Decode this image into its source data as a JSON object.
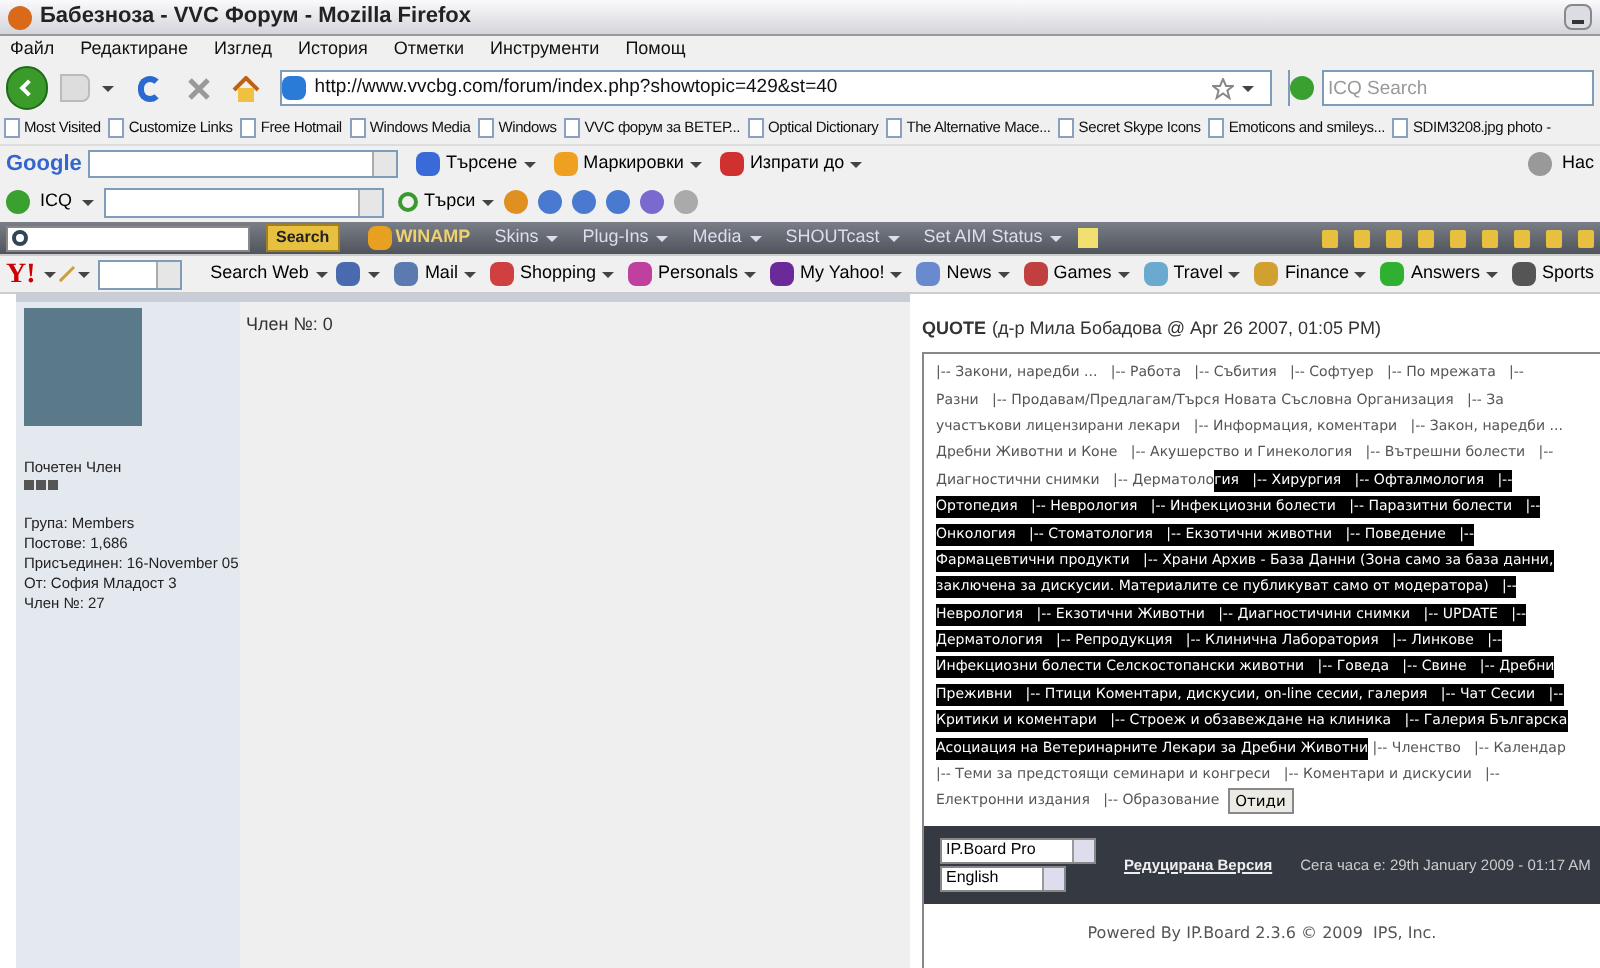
{
  "window": {
    "title": "Бабезноза - VVC Форум - Mozilla Firefox"
  },
  "menu": [
    "Файл",
    "Редактиране",
    "Изглед",
    "История",
    "Отметки",
    "Инструменти",
    "Помощ"
  ],
  "nav": {
    "url": "http://www.vvcbg.com/forum/index.php?showtopic=429&st=40",
    "search_placeholder": "ICQ Search"
  },
  "bookmarks": [
    "Most Visited",
    "Customize Links",
    "Free Hotmail",
    "Windows Media",
    "Windows",
    "VVC форум за ВЕТЕР...",
    "Optical Dictionary",
    "The Alternative Mace...",
    "Secret Skype Icons",
    "Emoticons and smileys...",
    "SDIM3208.jpg photo -"
  ],
  "google_toolbar": {
    "logo": "Google",
    "items": [
      "Търсене",
      "Маркировки",
      "Изпрати до"
    ],
    "cut_label": "Нас"
  },
  "icq_toolbar": {
    "label": "ICQ",
    "search": "Търси"
  },
  "winamp_toolbar": {
    "search_button": "Search",
    "logo": "WINAMP",
    "menus": [
      "Skins",
      "Plug-Ins",
      "Media",
      "SHOUTcast",
      "Set AIM Status"
    ]
  },
  "yahoo_toolbar": {
    "logo": "Y!",
    "search": "Search Web",
    "items": [
      "Mail",
      "Shopping",
      "Personals",
      "My Yahoo!",
      "News",
      "Games",
      "Travel",
      "Finance",
      "Answers",
      "Sports"
    ]
  },
  "profile": {
    "title": "Почетен Член",
    "details": [
      "Група: Members",
      "Постове: 1,686",
      "Присъединен: 16-November 05",
      "От: София Младост 3",
      "Член №: 27"
    ]
  },
  "post": {
    "member_no": "Член №: 0"
  },
  "quote": {
    "label": "QUOTE",
    "source": "(д-р Мила Бобадова @ Apr 26 2007, 01:05 PM)",
    "lines": [
      {
        "segments": [
          {
            "text": "|-- Закони, наредби ...   |-- Работа   |-- Събития   |-- Софтуер   |-- По мрежата   |--",
            "highlighted": false
          }
        ]
      },
      {
        "segments": [
          {
            "text": "Разни   |-- Продавам/Предлагам/Търся Новата Съсловна Организация   |-- За",
            "highlighted": false
          }
        ]
      },
      {
        "segments": [
          {
            "text": "участъкови лицензирани лекари   |-- Информация, коментари   |-- Закон, наредби ...",
            "highlighted": false
          }
        ]
      },
      {
        "segments": [
          {
            "text": "Дребни Животни и Коне   |-- Акушерство и Гинекология   |-- Вътрешни болести   |--",
            "highlighted": false
          }
        ]
      },
      {
        "segments": [
          {
            "text": "Диагностични снимки   |-- Дерматоло",
            "highlighted": false
          },
          {
            "text": "гия   |-- Хирургия   |-- Офталмология   |--",
            "highlighted": true
          }
        ]
      },
      {
        "segments": [
          {
            "text": "Ортопедия   |-- Неврология   |-- Инфекциозни болести   |-- Паразитни болести   |--",
            "highlighted": true
          }
        ]
      },
      {
        "segments": [
          {
            "text": "Онкология   |-- Стоматология   |-- Екзотични животни   |-- Поведение   |--",
            "highlighted": true
          }
        ]
      },
      {
        "segments": [
          {
            "text": "Фармацевтични продукти   |-- Храни Архив - База Данни (Зона само за база данни,",
            "highlighted": true
          }
        ]
      },
      {
        "segments": [
          {
            "text": "заключена за дискусии. Материалите се публикуват само от модератора)   |--",
            "highlighted": true
          }
        ]
      },
      {
        "segments": [
          {
            "text": "Неврология   |-- Екзотични Животни   |-- Диагностичини снимки   |-- UPDATE   |--",
            "highlighted": true
          }
        ]
      },
      {
        "segments": [
          {
            "text": "Дерматология   |-- Репродукция   |-- Клинична Лаборатория   |-- Линкове   |--",
            "highlighted": true
          }
        ]
      },
      {
        "segments": [
          {
            "text": "Инфекциозни болести Селскостопански животни   |-- Говеда   |-- Свине   |-- Дребни",
            "highlighted": true
          }
        ]
      },
      {
        "segments": [
          {
            "text": "Преживни   |-- Птици Коментари, дискусии, on-line сесии, галерия   |-- Чат Сесии   |--",
            "highlighted": true
          }
        ]
      },
      {
        "segments": [
          {
            "text": "Критики и коментари   |-- Строеж и обзавеждане на клиника   |-- Галерия Българска",
            "highlighted": true
          }
        ]
      },
      {
        "segments": [
          {
            "text": "Асоциация на Ветеринарните Лекари за Дребни Животни",
            "highlighted": true
          },
          {
            "text": " |-- Членство   |-- Календар",
            "highlighted": false
          }
        ]
      },
      {
        "segments": [
          {
            "text": "|-- Теми за предстоящи семинари и конгреси   |-- Коментари и дискусии   |--",
            "highlighted": false
          }
        ]
      },
      {
        "segments": [
          {
            "text": "Електронни издания   |-- Образование",
            "highlighted": false
          }
        ]
      }
    ],
    "go_button": "Отиди"
  },
  "footer": {
    "skin": "IP.Board Pro",
    "language": "English",
    "lite_link": "Редуцирана Версия",
    "time": "Сега часа е: 29th January 2009 - 01:17 AM",
    "powered": "Powered By IP.Board 2.3.6 © 2009  IPS, Inc."
  }
}
